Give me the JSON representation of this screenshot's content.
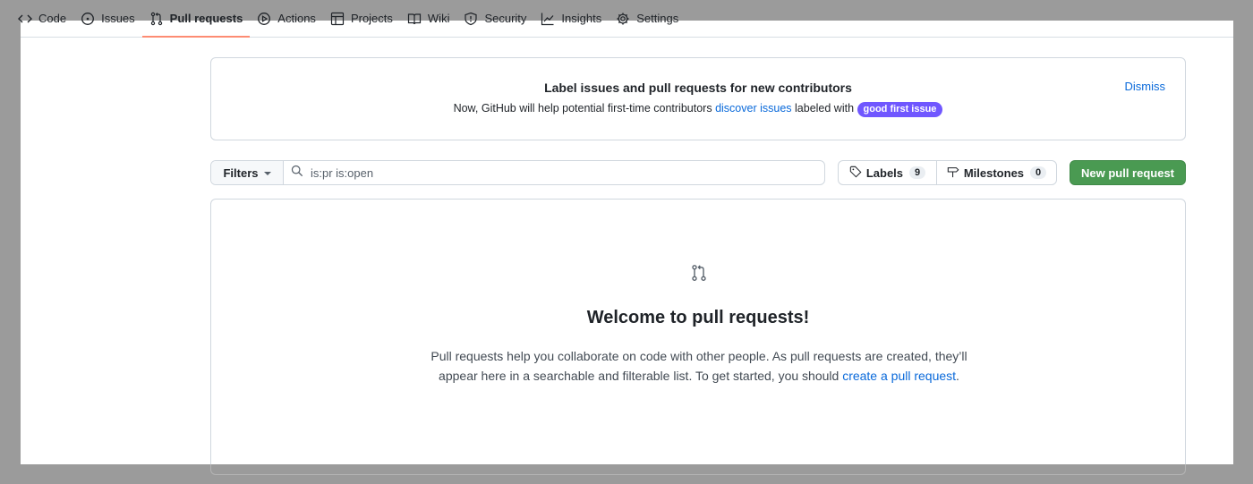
{
  "nav": {
    "tabs": [
      {
        "label": "Code",
        "icon": "code-icon"
      },
      {
        "label": "Issues",
        "icon": "issue-icon"
      },
      {
        "label": "Pull requests",
        "icon": "pull-request-icon",
        "active": true
      },
      {
        "label": "Actions",
        "icon": "play-icon"
      },
      {
        "label": "Projects",
        "icon": "table-icon"
      },
      {
        "label": "Wiki",
        "icon": "book-icon"
      },
      {
        "label": "Security",
        "icon": "shield-icon"
      },
      {
        "label": "Insights",
        "icon": "graph-icon"
      },
      {
        "label": "Settings",
        "icon": "gear-icon"
      }
    ]
  },
  "banner": {
    "title": "Label issues and pull requests for new contributors",
    "desc_prefix": "Now, GitHub will help potential first-time contributors",
    "desc_link": "discover issues",
    "desc_middle": "labeled with",
    "label_badge": "good first issue",
    "dismiss": "Dismiss"
  },
  "filters": {
    "button_label": "Filters",
    "search_value": "is:pr is:open"
  },
  "labels": {
    "label": "Labels",
    "count": "9"
  },
  "milestones": {
    "label": "Milestones",
    "count": "0"
  },
  "new_pr_button": "New pull request",
  "blank": {
    "heading": "Welcome to pull requests!",
    "text": "Pull requests help you collaborate on code with other people. As pull requests are created, they’ll appear here in a searchable and filterable list. To get started, you should",
    "link": "create a pull request",
    "end": "."
  },
  "colors": {
    "accent_link": "#0969da",
    "primary_button": "#4a9a52",
    "label_badge": "#7057ff",
    "active_tab_underline": "#fd8c73"
  }
}
